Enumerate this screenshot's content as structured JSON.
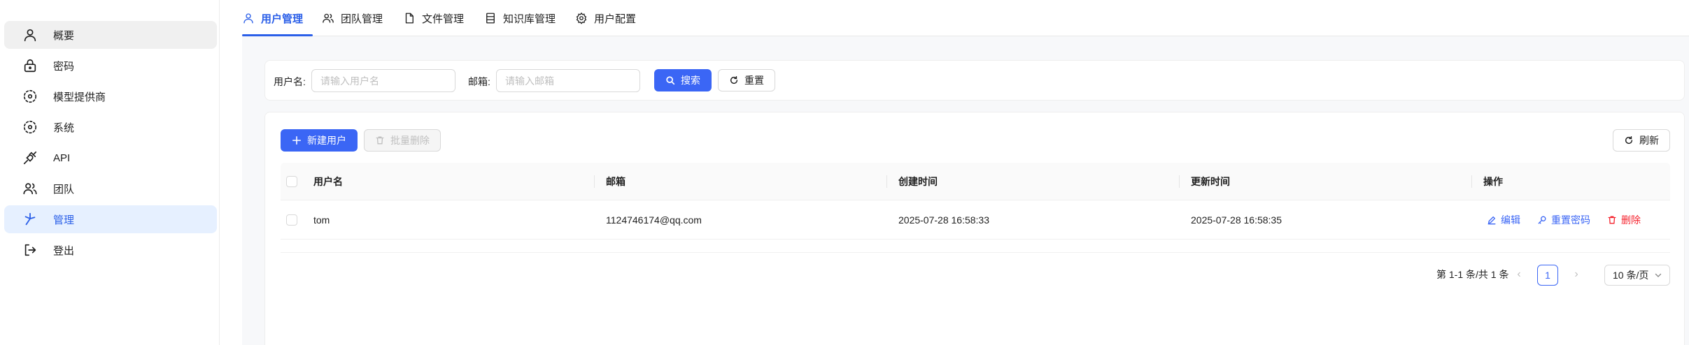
{
  "sidebar": {
    "items": [
      {
        "label": "概要",
        "icon": "user-icon"
      },
      {
        "label": "密码",
        "icon": "lock-icon"
      },
      {
        "label": "模型提供商",
        "icon": "model-provider-icon"
      },
      {
        "label": "系统",
        "icon": "system-icon"
      },
      {
        "label": "API",
        "icon": "api-plug-icon"
      },
      {
        "label": "团队",
        "icon": "team-icon"
      },
      {
        "label": "管理",
        "icon": "admin-icon"
      },
      {
        "label": "登出",
        "icon": "logout-icon"
      }
    ],
    "hover_index": 0,
    "active_index": 6
  },
  "tabs": [
    {
      "label": "用户管理",
      "icon": "user-icon"
    },
    {
      "label": "团队管理",
      "icon": "team-icon"
    },
    {
      "label": "文件管理",
      "icon": "file-icon"
    },
    {
      "label": "知识库管理",
      "icon": "knowledge-base-icon"
    },
    {
      "label": "用户配置",
      "icon": "gear-icon"
    }
  ],
  "search": {
    "username_label": "用户名:",
    "username_placeholder": "请输入用户名",
    "email_label": "邮箱:",
    "email_placeholder": "请输入邮箱",
    "search_button": "搜索",
    "reset_button": "重置"
  },
  "toolbar": {
    "new_user": "新建用户",
    "batch_delete": "批量删除",
    "refresh": "刷新"
  },
  "table": {
    "columns": [
      "用户名",
      "邮箱",
      "创建时间",
      "更新时间",
      "操作"
    ],
    "rows": [
      {
        "username": "tom",
        "email": "1124746174@qq.com",
        "created": "2025-07-28 16:58:33",
        "updated": "2025-07-28 16:58:35",
        "actions": {
          "edit": "编辑",
          "reset_password": "重置密码",
          "delete": "删除"
        }
      }
    ]
  },
  "pagination": {
    "summary": "第 1-1 条/共 1 条",
    "current_page": "1",
    "page_size": "10 条/页",
    "prev": "‹",
    "next": "›"
  },
  "colors": {
    "accent": "#3b66f5",
    "active_bg": "#e6f0ff",
    "danger": "#f5222d"
  }
}
